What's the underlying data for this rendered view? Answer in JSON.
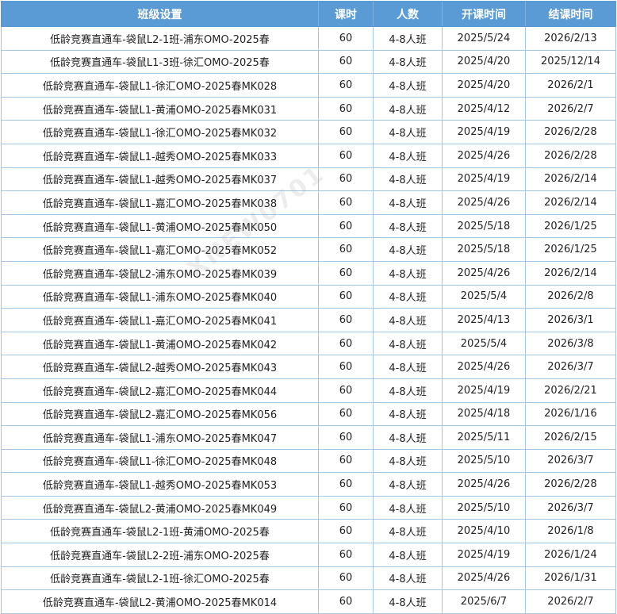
{
  "header": {
    "class_setting": "班级设置",
    "hours": "课时",
    "class_size": "人数",
    "start_time": "开课时间",
    "end_time": "结课时间"
  },
  "watermark": "XNEW0701",
  "rows": [
    {
      "name": "低龄竞赛直通车-袋鼠L2-1班-浦东OMO-2025春",
      "hours": "60",
      "size": "4-8人班",
      "start": "2025/5/24",
      "end": "2026/2/13"
    },
    {
      "name": "低龄竞赛直通车-袋鼠L1-3班-徐汇OMO-2025春",
      "hours": "60",
      "size": "4-8人班",
      "start": "2025/4/20",
      "end": "2025/12/14"
    },
    {
      "name": "低龄竞赛直通车-袋鼠L1-徐汇OMO-2025春MK028",
      "hours": "60",
      "size": "4-8人班",
      "start": "2025/4/20",
      "end": "2026/2/1"
    },
    {
      "name": "低龄竞赛直通车-袋鼠L1-黄浦OMO-2025春MK031",
      "hours": "60",
      "size": "4-8人班",
      "start": "2025/4/12",
      "end": "2026/2/7"
    },
    {
      "name": "低龄竞赛直通车-袋鼠L1-徐汇OMO-2025春MK032",
      "hours": "60",
      "size": "4-8人班",
      "start": "2025/4/19",
      "end": "2026/2/28"
    },
    {
      "name": "低龄竞赛直通车-袋鼠L1-越秀OMO-2025春MK033",
      "hours": "60",
      "size": "4-8人班",
      "start": "2025/4/26",
      "end": "2026/2/28"
    },
    {
      "name": "低龄竞赛直通车-袋鼠L1-越秀OMO-2025春MK037",
      "hours": "60",
      "size": "4-8人班",
      "start": "2025/4/19",
      "end": "2026/2/14"
    },
    {
      "name": "低龄竞赛直通车-袋鼠L1-嘉汇OMO-2025春MK038",
      "hours": "60",
      "size": "4-8人班",
      "start": "2025/4/26",
      "end": "2026/2/14"
    },
    {
      "name": "低龄竞赛直通车-袋鼠L1-黄浦OMO-2025春MK050",
      "hours": "60",
      "size": "4-8人班",
      "start": "2025/5/18",
      "end": "2026/1/25"
    },
    {
      "name": "低龄竞赛直通车-袋鼠L1-嘉汇OMO-2025春MK052",
      "hours": "60",
      "size": "4-8人班",
      "start": "2025/5/18",
      "end": "2026/1/25"
    },
    {
      "name": "低龄竞赛直通车-袋鼠L2-浦东OMO-2025春MK039",
      "hours": "60",
      "size": "4-8人班",
      "start": "2025/4/26",
      "end": "2026/2/14"
    },
    {
      "name": "低龄竞赛直通车-袋鼠L1-浦东OMO-2025春MK040",
      "hours": "60",
      "size": "4-8人班",
      "start": "2025/5/4",
      "end": "2026/2/8"
    },
    {
      "name": "低龄竞赛直通车-袋鼠L1-嘉汇OMO-2025春MK041",
      "hours": "60",
      "size": "4-8人班",
      "start": "2025/4/13",
      "end": "2026/3/1"
    },
    {
      "name": "低龄竞赛直通车-袋鼠L1-黄浦OMO-2025春MK042",
      "hours": "60",
      "size": "4-8人班",
      "start": "2025/5/4",
      "end": "2026/3/8"
    },
    {
      "name": "低龄竞赛直通车-袋鼠L2-越秀OMO-2025春MK043",
      "hours": "60",
      "size": "4-8人班",
      "start": "2025/4/26",
      "end": "2026/3/7"
    },
    {
      "name": "低龄竞赛直通车-袋鼠L2-嘉汇OMO-2025春MK044",
      "hours": "60",
      "size": "4-8人班",
      "start": "2025/4/19",
      "end": "2026/2/21"
    },
    {
      "name": "低龄竞赛直通车-袋鼠L2-嘉汇OMO-2025春MK056",
      "hours": "60",
      "size": "4-8人班",
      "start": "2025/4/18",
      "end": "2026/1/16"
    },
    {
      "name": "低龄竞赛直通车-袋鼠L1-浦东OMO-2025春MK047",
      "hours": "60",
      "size": "4-8人班",
      "start": "2025/5/11",
      "end": "2026/2/15"
    },
    {
      "name": "低龄竞赛直通车-袋鼠L1-徐汇OMO-2025春MK048",
      "hours": "60",
      "size": "4-8人班",
      "start": "2025/5/10",
      "end": "2026/3/7"
    },
    {
      "name": "低龄竞赛直通车-袋鼠L1-越秀OMO-2025春MK053",
      "hours": "60",
      "size": "4-8人班",
      "start": "2025/4/26",
      "end": "2026/2/28"
    },
    {
      "name": "低龄竞赛直通车-袋鼠L2-黄浦OMO-2025春MK049",
      "hours": "60",
      "size": "4-8人班",
      "start": "2025/5/10",
      "end": "2026/3/7"
    },
    {
      "name": "低龄竞赛直通车-袋鼠L2-1班-黄浦OMO-2025春",
      "hours": "60",
      "size": "4-8人班",
      "start": "2025/4/10",
      "end": "2026/1/8"
    },
    {
      "name": "低龄竞赛直通车-袋鼠L2-2班-浦东OMO-2025春",
      "hours": "60",
      "size": "4-8人班",
      "start": "2025/4/19",
      "end": "2026/1/24"
    },
    {
      "name": "低龄竞赛直通车-袋鼠L2-1班-徐汇OMO-2025春",
      "hours": "60",
      "size": "4-8人班",
      "start": "2025/4/26",
      "end": "2026/1/31"
    },
    {
      "name": "低龄竞赛直通车-袋鼠L2-黄浦OMO-2025春MK014",
      "hours": "60",
      "size": "4-8人班",
      "start": "2025/6/7",
      "end": "2026/2/7"
    }
  ]
}
